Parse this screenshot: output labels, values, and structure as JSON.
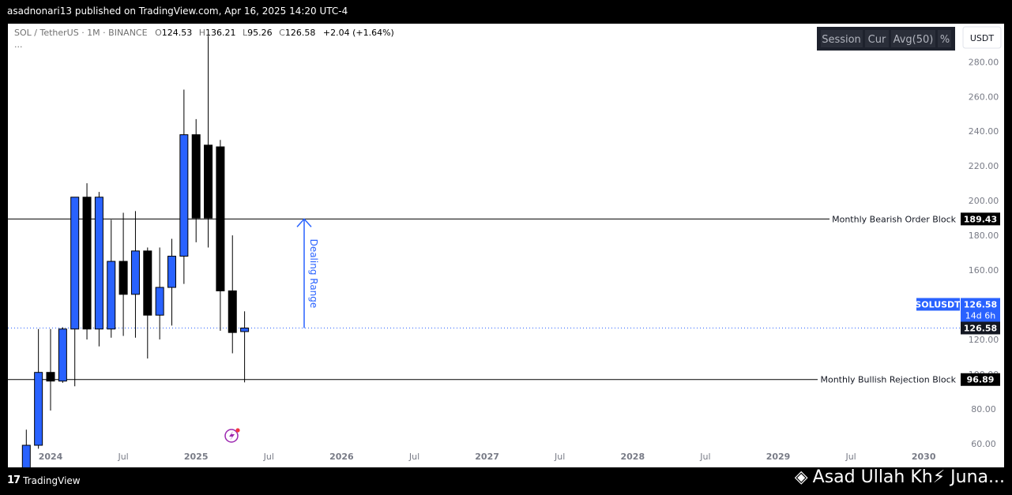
{
  "publisher_line": "asadnonari13 published on TradingView.com, Apr 16, 2025 14:20 UTC-4",
  "legend": {
    "symbol": "SOL / TetherUS · 1M · BINANCE",
    "o_label": "O",
    "o_value": "124.53",
    "h_label": "H",
    "h_value": "136.21",
    "l_label": "L",
    "l_value": "95.26",
    "c_label": "C",
    "c_value": "126.58",
    "change": "+2.04 (+1.64%)",
    "more": "···"
  },
  "toolbar": {
    "buttons": [
      "Session",
      "Cur",
      "Avg(50)",
      "%"
    ],
    "currency": "USDT"
  },
  "levels": {
    "bearish_label": "Monthly Bearish Order Block",
    "bearish_value": "189.43",
    "bullish_label": "Monthly Bullish Rejection Block",
    "bullish_value": "96.89",
    "current_symbol": "SOLUSDT",
    "current_value": "126.58",
    "countdown": "14d 6h",
    "current_value_line": "126.58"
  },
  "annotation": {
    "dealing_range": "Dealing Range"
  },
  "footer": {
    "brand": "TradingView",
    "watermark": "Asad Ullah Kh⚡ Juna..."
  },
  "colors": {
    "bull": "#2962ff",
    "bear": "#000000",
    "arrow": "#2962ff",
    "badge_current": "#2962ff",
    "badge_level": "#000000",
    "event_icon": "#9c27b0"
  },
  "chart_data": {
    "type": "candlestick",
    "title": "SOL / TetherUS · 1M · BINANCE",
    "x_ticks": [
      "2024",
      "Jul",
      "2025",
      "Jul",
      "2026",
      "Jul",
      "2027",
      "Jul",
      "2028",
      "Jul",
      "2029",
      "Jul",
      "2030"
    ],
    "y_ticks": [
      "60.00",
      "80.00",
      "100.00",
      "120.00",
      "140.00",
      "160.00",
      "180.00",
      "200.00",
      "220.00",
      "240.00",
      "260.00",
      "280.00"
    ],
    "ylim": [
      59,
      302
    ],
    "candles": [
      {
        "month": "2023-11",
        "o": 38,
        "h": 68,
        "l": 55,
        "c": 59
      },
      {
        "month": "2023-12",
        "o": 59,
        "h": 126,
        "l": 57,
        "c": 101
      },
      {
        "month": "2024-01",
        "o": 101,
        "h": 126,
        "l": 79,
        "c": 96
      },
      {
        "month": "2024-02",
        "o": 96,
        "h": 127,
        "l": 95,
        "c": 126
      },
      {
        "month": "2024-03",
        "o": 126,
        "h": 136,
        "l": 93,
        "c": 202
      },
      {
        "month": "2024-04",
        "o": 202,
        "h": 210,
        "l": 120,
        "c": 126
      },
      {
        "month": "2024-05",
        "o": 126,
        "h": 205,
        "l": 116,
        "c": 202
      },
      {
        "month": "2024-06",
        "o": 126,
        "h": 189,
        "l": 121,
        "c": 165
      },
      {
        "month": "2024-07",
        "o": 165,
        "h": 193,
        "l": 122,
        "c": 146
      },
      {
        "month": "2024-08",
        "o": 146,
        "h": 194,
        "l": 121,
        "c": 171
      },
      {
        "month": "2024-09",
        "o": 171,
        "h": 173,
        "l": 109,
        "c": 134
      },
      {
        "month": "2024-10",
        "o": 134,
        "h": 173,
        "l": 120,
        "c": 150
      },
      {
        "month": "2024-11",
        "o": 150,
        "h": 178,
        "l": 128,
        "c": 168
      },
      {
        "month": "2024-12",
        "o": 168,
        "h": 264,
        "l": 152,
        "c": 238
      },
      {
        "month": "2025-01",
        "o": 238,
        "h": 247,
        "l": 176,
        "c": 190
      },
      {
        "month": "2025-02",
        "o": 232,
        "h": 295,
        "l": 173,
        "c": 190
      },
      {
        "month": "2025-03",
        "o": 231,
        "h": 235,
        "l": 125,
        "c": 148
      },
      {
        "month": "2025-04",
        "o": 148,
        "h": 180,
        "l": 112,
        "c": 124
      },
      {
        "month": "2025-05",
        "o": 124.53,
        "h": 136.21,
        "l": 95.26,
        "c": 126.58
      }
    ],
    "horizontal_lines": [
      {
        "label": "Monthly Bearish Order Block",
        "value": 189.43
      },
      {
        "label": "Monthly Bullish Rejection Block",
        "value": 96.89
      }
    ],
    "current_price": 126.58,
    "annotations": [
      "Dealing Range"
    ]
  }
}
